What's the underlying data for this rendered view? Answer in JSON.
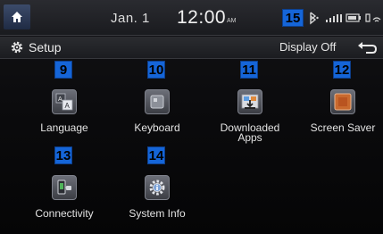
{
  "statusbar": {
    "date": "Jan.  1",
    "time": "12:00",
    "ampm": "AM",
    "badge": "15"
  },
  "header": {
    "title": "Setup",
    "display_off_label": "Display Off"
  },
  "menu": [
    {
      "badge": "9",
      "label": "Language",
      "icon": "language-icon"
    },
    {
      "badge": "10",
      "label": "Keyboard",
      "icon": "keyboard-icon"
    },
    {
      "badge": "11",
      "label": "Downloaded Apps",
      "icon": "download-icon"
    },
    {
      "badge": "12",
      "label": "Screen Saver",
      "icon": "screen-saver-icon"
    },
    {
      "badge": "13",
      "label": "Connectivity",
      "icon": "connectivity-icon"
    },
    {
      "badge": "14",
      "label": "System Info",
      "icon": "system-info-icon"
    }
  ],
  "colors": {
    "badge_blue": "#1565d8",
    "home_blue": "#2a3a5a"
  }
}
